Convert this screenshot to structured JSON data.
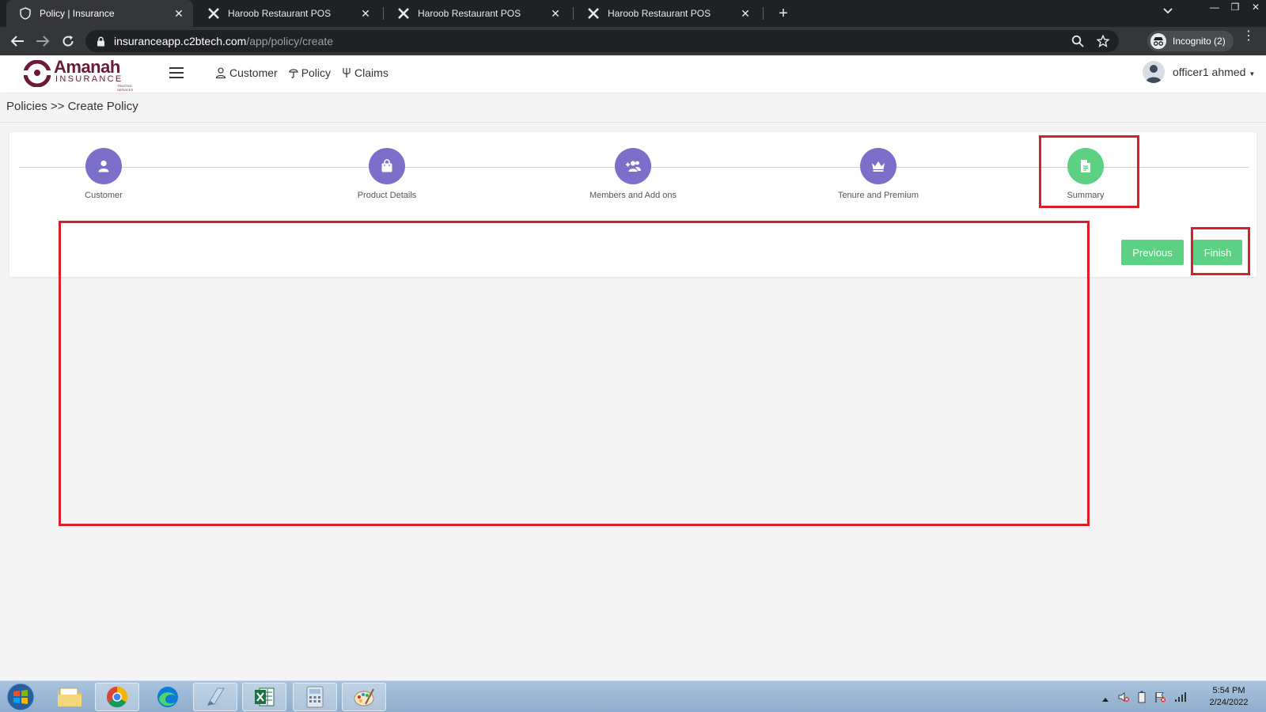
{
  "browser": {
    "tabs": [
      {
        "title": "Policy | Insurance",
        "active": true
      },
      {
        "title": "Haroob Restaurant POS",
        "active": false
      },
      {
        "title": "Haroob Restaurant POS",
        "active": false
      },
      {
        "title": "Haroob Restaurant POS",
        "active": false
      }
    ],
    "url_domain": "insuranceapp.c2btech.com",
    "url_path": "/app/policy/create",
    "incognito_label": "Incognito (2)"
  },
  "app": {
    "logo_word": "Amanah",
    "logo_sub": "INSURANCE",
    "logo_tiny": "TRUSTED SERVICES",
    "nav": [
      {
        "label": "Customer",
        "icon": "user-icon"
      },
      {
        "label": "Policy",
        "icon": "umbrella-icon"
      },
      {
        "label": "Claims",
        "icon": "claims-icon"
      }
    ],
    "user_name": "officer1 ahmed"
  },
  "breadcrumb": {
    "root": "Policies",
    "separator": ">>",
    "current": "Create Policy"
  },
  "wizard": {
    "steps": [
      {
        "label": "Customer",
        "icon": "user-icon",
        "status": "pending"
      },
      {
        "label": "Product Details",
        "icon": "shopping-bag-icon",
        "status": "pending"
      },
      {
        "label": "Members and Add ons",
        "icon": "users-plus-icon",
        "status": "pending"
      },
      {
        "label": "Tenure and Premium",
        "icon": "crown-icon",
        "status": "pending"
      },
      {
        "label": "Summary",
        "icon": "document-icon",
        "status": "active"
      }
    ],
    "previous_label": "Previous",
    "finish_label": "Finish"
  },
  "taskbar": {
    "time": "5:54 PM",
    "date": "2/24/2022"
  },
  "colors": {
    "step_pending": "#7b6fc9",
    "step_active": "#5cd083",
    "button": "#5cd083",
    "highlight": "#d81f2a",
    "brand": "#6a1b3a"
  }
}
